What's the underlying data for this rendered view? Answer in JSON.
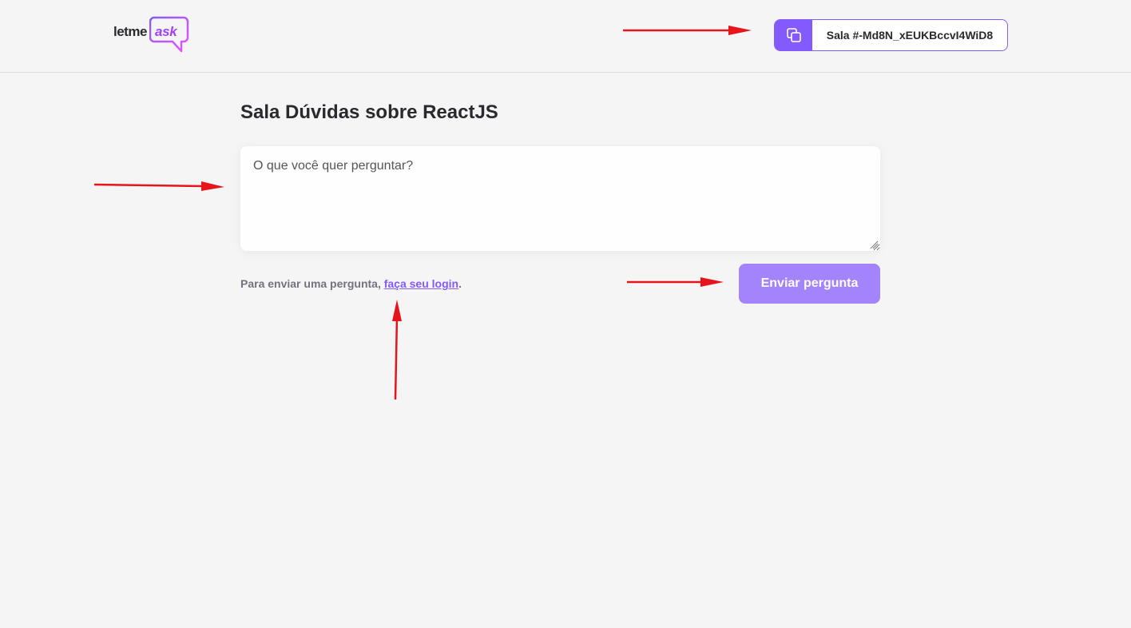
{
  "header": {
    "logo": {
      "part1": "letme",
      "part2": "ask"
    },
    "room_code": {
      "label": "Sala #-Md8N_xEUKBccvI4WiD8",
      "icon": "copy-icon"
    }
  },
  "main": {
    "title": "Sala Dúvidas sobre ReactJS",
    "question_input": {
      "placeholder": "O que você quer perguntar?",
      "value": ""
    },
    "login_hint": {
      "prefix": "Para enviar uma pergunta, ",
      "link": "faça seu login",
      "suffix": "."
    },
    "send_button": {
      "label": "Enviar pergunta",
      "disabled": true
    }
  },
  "colors": {
    "accent": "#835afd",
    "button_disabled": "#a384fc",
    "annotation_arrow": "#e6141b"
  }
}
